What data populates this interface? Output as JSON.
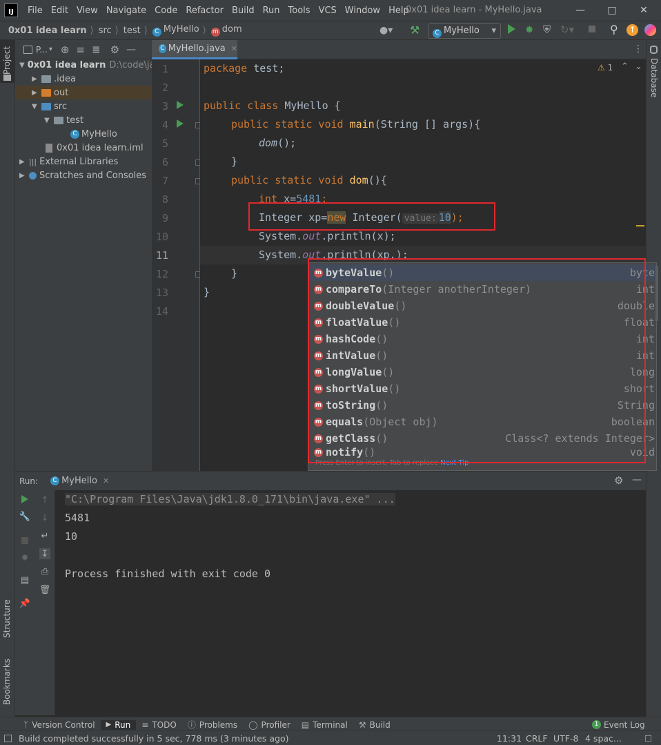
{
  "app": {
    "logo": "IJ",
    "menu": [
      "File",
      "Edit",
      "View",
      "Navigate",
      "Code",
      "Refactor",
      "Build",
      "Run",
      "Tools",
      "VCS",
      "Window",
      "Help"
    ],
    "window_title": "0x01 idea learn - MyHello.java"
  },
  "navbar": {
    "project": "0x01 idea learn",
    "crumbs": [
      "src",
      "test",
      "MyHello",
      "dom"
    ],
    "run_config": "MyHello"
  },
  "project_panel": {
    "title": "P...",
    "root_name": "0x01 idea learn",
    "root_path": "D:\\code\\ja",
    "items": [
      ".idea",
      "out",
      "src",
      "test",
      "MyHello",
      "0x01 idea learn.iml",
      "External Libraries",
      "Scratches and Consoles"
    ]
  },
  "left_strip": {
    "project": "Project",
    "structure": "Structure",
    "bookmarks": "Bookmarks"
  },
  "right_strip": {
    "database": "Database"
  },
  "editor": {
    "tab": "MyHello.java",
    "line_numbers": [
      "1",
      "2",
      "3",
      "4",
      "5",
      "6",
      "7",
      "8",
      "9",
      "10",
      "11",
      "12",
      "13",
      "14"
    ],
    "warnings": "1",
    "param_hint": "value:",
    "code": {
      "l1_kw": "package",
      "l1_rest": " test;",
      "l3_kw": "public class",
      "l3_rest": " MyHello {",
      "l4_kw": "public static void",
      "l4_fn": "main",
      "l4_rest": "(String [] args){",
      "l5_call": "dom",
      "l5_rest": "();",
      "l6": "}",
      "l7_kw": "public static void",
      "l7_fn": "dom",
      "l7_rest": "(){",
      "l8_kw": "int",
      "l8_var": " x=",
      "l8_num": "5481",
      "l8_end": ";",
      "l9_a": "Integer xp=",
      "l9_new": "new",
      "l9_b": " Integer(",
      "l9_num": "10",
      "l9_c": ");",
      "l10_a": "System.",
      "l10_out": "out",
      "l10_b": ".println(x);",
      "l11_a": "System.",
      "l11_out": "out",
      "l11_b": ".println(xp.);",
      "l12": "}",
      "l13": "}"
    }
  },
  "completion": {
    "items": [
      {
        "name": "byteValue",
        "params": "()",
        "type": "byte"
      },
      {
        "name": "compareTo",
        "params": "(Integer anotherInteger)",
        "type": "int"
      },
      {
        "name": "doubleValue",
        "params": "()",
        "type": "double"
      },
      {
        "name": "floatValue",
        "params": "()",
        "type": "float"
      },
      {
        "name": "hashCode",
        "params": "()",
        "type": "int"
      },
      {
        "name": "intValue",
        "params": "()",
        "type": "int"
      },
      {
        "name": "longValue",
        "params": "()",
        "type": "long"
      },
      {
        "name": "shortValue",
        "params": "()",
        "type": "short"
      },
      {
        "name": "toString",
        "params": "()",
        "type": "String"
      },
      {
        "name": "equals",
        "params": "(Object obj)",
        "type": "boolean"
      },
      {
        "name": "getClass",
        "params": "()",
        "type": "Class<? extends Integer>"
      },
      {
        "name": "notify",
        "params": "()",
        "type": "void"
      }
    ],
    "tip": "Press Enter to insert, Tab to replace",
    "next_tip": "Next Tip"
  },
  "run_panel": {
    "label": "Run:",
    "tab": "MyHello",
    "console": [
      "\"C:\\Program Files\\Java\\jdk1.8.0_171\\bin\\java.exe\" ...",
      "5481",
      "10",
      "",
      "Process finished with exit code 0"
    ]
  },
  "bottom_tabs": [
    "Version Control",
    "Run",
    "TODO",
    "Problems",
    "Profiler",
    "Terminal",
    "Build"
  ],
  "event_log": "Event Log",
  "status": {
    "message": "Build completed successfully in 5 sec, 778 ms (3 minutes ago)",
    "position": "11:31",
    "line_sep": "CRLF",
    "encoding": "UTF-8",
    "indent": "4 spac..."
  }
}
